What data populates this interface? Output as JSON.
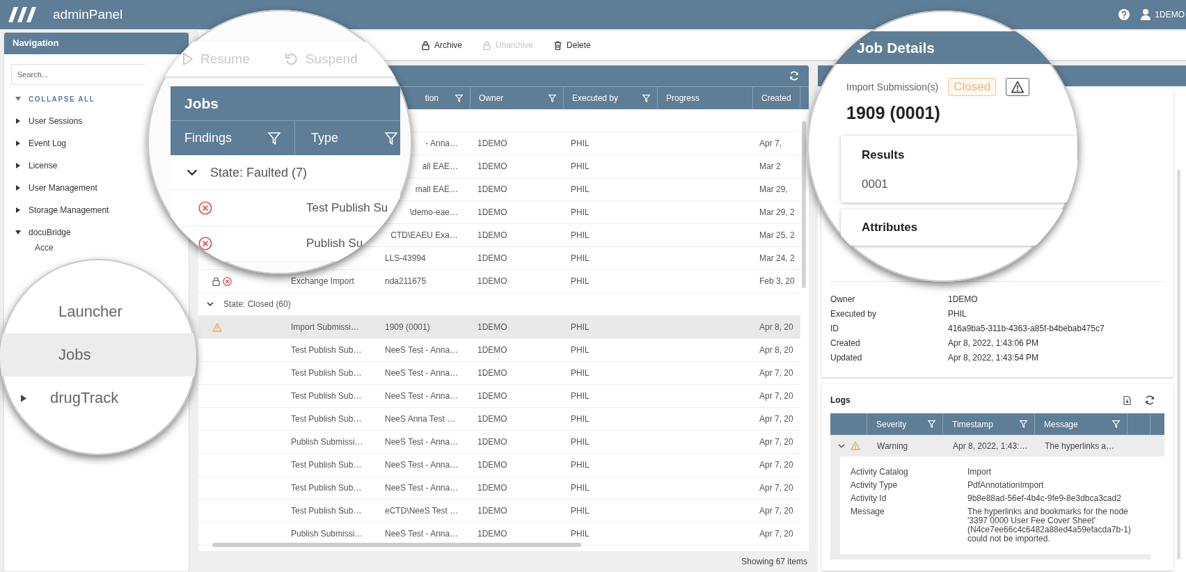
{
  "app": {
    "title": "adminPanel",
    "user": "1DEMO"
  },
  "navigation": {
    "title": "Navigation",
    "search": {
      "placeholder": "Search..."
    },
    "collapse_all": "COLLAPSE ALL",
    "items": [
      {
        "label": "User Sessions",
        "expanded": false
      },
      {
        "label": "Event Log",
        "expanded": false
      },
      {
        "label": "License",
        "expanded": false
      },
      {
        "label": "User Management",
        "expanded": false
      },
      {
        "label": "Storage Management",
        "expanded": false
      },
      {
        "label": "docuBridge",
        "expanded": true,
        "children": [
          {
            "label": "Acce"
          }
        ]
      }
    ]
  },
  "nav_magnifier": {
    "items": [
      {
        "label": "Launcher",
        "kind": "leaf",
        "selected": false
      },
      {
        "label": "Jobs",
        "kind": "leaf",
        "selected": true
      },
      {
        "label": "drugTrack",
        "kind": "folder",
        "selected": false,
        "expanded": false
      }
    ]
  },
  "toolbar": {
    "buttons": [
      {
        "label": "Archive",
        "kind": "lock",
        "disabled": false
      },
      {
        "label": "Unarchive",
        "kind": "lock",
        "disabled": true
      },
      {
        "label": "Delete",
        "kind": "trash",
        "disabled": false
      }
    ]
  },
  "jobs_magnifier": {
    "buttons": [
      {
        "label": "Resume",
        "kind": "play",
        "disabled": true
      },
      {
        "label": "Suspend",
        "kind": "undo",
        "disabled": true
      }
    ],
    "title": "Jobs",
    "columns": [
      "Findings",
      "Type"
    ],
    "group": {
      "label": "State: Faulted (7)",
      "expanded": true
    },
    "rows": [
      {
        "findings": [
          {
            "kind": "error"
          }
        ],
        "type": "Test Publish Su"
      },
      {
        "findings": [
          {
            "kind": "error"
          }
        ],
        "type": "Publish Su"
      }
    ]
  },
  "jobs_table": {
    "columns": [
      {
        "label": "tion",
        "clipped": true,
        "filter": true
      },
      {
        "label": "Owner",
        "clipped": false,
        "filter": true
      },
      {
        "label": "Executed by",
        "clipped": false,
        "filter": true
      },
      {
        "label": "Progress",
        "clipped": false,
        "filter": false
      },
      {
        "label": "Created",
        "clipped": false,
        "filter": false
      }
    ],
    "faulted_rows": [
      {
        "description": "- Anna…",
        "clipped": true,
        "owner": "1DEMO",
        "executed_by": "PHIL",
        "created": "Apr 7,"
      },
      {
        "description": "all EAE…",
        "clipped": true,
        "owner": "1DEMO",
        "executed_by": "PHIL",
        "created": "Mar 2"
      },
      {
        "description": "mall EAE…",
        "clipped": true,
        "owner": "1DEMO",
        "executed_by": "PHIL",
        "created": "Mar 29,"
      },
      {
        "description": "\\demo-eae…",
        "clipped": true,
        "owner": "1DEMO",
        "executed_by": "PHIL",
        "created": "Mar 29, 2"
      },
      {
        "description": "CTD\\EAEU Exa…",
        "clipped": true,
        "owner": "1DEMO",
        "executed_by": "PHIL",
        "created": "Mar 25, 2"
      },
      {
        "description": "LLS-43994",
        "clipped": false,
        "owner": "1DEMO",
        "executed_by": "PHIL",
        "created": "Mar 24, 2"
      },
      {
        "findings": [
          {
            "kind": "lock"
          },
          {
            "kind": "error"
          }
        ],
        "type": "Exchange Import",
        "description": "nda211675",
        "clipped": false,
        "owner": "1DEMO",
        "executed_by": "PHIL",
        "created": "Feb 3, 20"
      }
    ],
    "closed_group": {
      "label": "State: Closed (60)",
      "expanded": true,
      "rows": [
        {
          "findings": [
            {
              "kind": "warning"
            }
          ],
          "type": "Import Submissi…",
          "description": "1909 (0001)",
          "owner": "1DEMO",
          "executed_by": "PHIL",
          "created": "Apr 8, 20",
          "selected": true
        },
        {
          "type": "Test Publish Sub…",
          "description": "NeeS Test - Anna…",
          "owner": "1DEMO",
          "executed_by": "PHIL",
          "created": "Apr 8, 20",
          "selected": false
        },
        {
          "type": "Test Publish Sub…",
          "description": "NeeS Test - Anna…",
          "owner": "1DEMO",
          "executed_by": "PHIL",
          "created": "Apr 7, 20",
          "selected": false
        },
        {
          "type": "Test Publish Sub…",
          "description": "NeeS Test - Anna…",
          "owner": "1DEMO",
          "executed_by": "PHIL",
          "created": "Apr 7, 20",
          "selected": false
        },
        {
          "type": "Test Publish Sub…",
          "description": "NeeS Anna Test …",
          "owner": "1DEMO",
          "executed_by": "PHIL",
          "created": "Apr 7, 20",
          "selected": false
        },
        {
          "type": "Publish Submissi…",
          "description": "NeeS Test - Anna…",
          "owner": "1DEMO",
          "executed_by": "PHIL",
          "created": "Apr 7, 20",
          "selected": false
        },
        {
          "type": "Test Publish Sub…",
          "description": "NeeS Test - Anna…",
          "owner": "1DEMO",
          "executed_by": "PHIL",
          "created": "Apr 7, 20",
          "selected": false
        },
        {
          "type": "Test Publish Sub…",
          "description": "NeeS Test - Anna…",
          "owner": "1DEMO",
          "executed_by": "PHIL",
          "created": "Apr 7, 20",
          "selected": false
        },
        {
          "type": "Test Publish Sub…",
          "description": "eCTD\\NeeS Test …",
          "owner": "1DEMO",
          "executed_by": "PHIL",
          "created": "Apr 7, 20",
          "selected": false
        },
        {
          "type": "Publish Submissi…",
          "description": "NeeS Test - Anna…",
          "owner": "1DEMO",
          "executed_by": "PHIL",
          "created": "Apr 7, 20",
          "selected": false
        }
      ]
    },
    "status": "Showing 67 items"
  },
  "details_magnifier": {
    "title": "Job Details",
    "job_type": "Import Submission(s)",
    "state": "Closed",
    "finding": {
      "kind": "warning"
    },
    "name": "1909 (0001)",
    "results_title": "Results",
    "result": "0001",
    "attributes_title": "Attributes"
  },
  "attributes": [
    {
      "label": "Owner",
      "value": "1DEMO"
    },
    {
      "label": "Executed by",
      "value": "PHIL"
    },
    {
      "label": "ID",
      "value": "416a9ba5-311b-4363-a85f-b4bebab475c7"
    },
    {
      "label": "Created",
      "value": "Apr 8, 2022, 1:43:06 PM"
    },
    {
      "label": "Updated",
      "value": "Apr 8, 2022, 1:43:54 PM"
    }
  ],
  "logs": {
    "title": "Logs",
    "columns": [
      "Severity",
      "Timestamp",
      "Message"
    ],
    "entries": [
      {
        "kind": "warning",
        "severity": "Warning",
        "timestamp": "Apr 8, 2022, 1:43:…",
        "message": "The hyperlinks a…",
        "expanded": true,
        "details": [
          {
            "label": "Activity Catalog",
            "value": "Import"
          },
          {
            "label": "Activity Type",
            "value": "PdfAnnotationImport"
          },
          {
            "label": "Activity Id",
            "value": "9b8e88ad-56ef-4b4c-9fe9-8e3dbca3cad2"
          },
          {
            "label": "Message",
            "value": "The hyperlinks and bookmarks for the node '3397 0000 User Fee Cover Sheet' (N4ce7ee66c4c6482a88ed4a59efacda7b-1) could not be imported."
          }
        ]
      }
    ]
  }
}
